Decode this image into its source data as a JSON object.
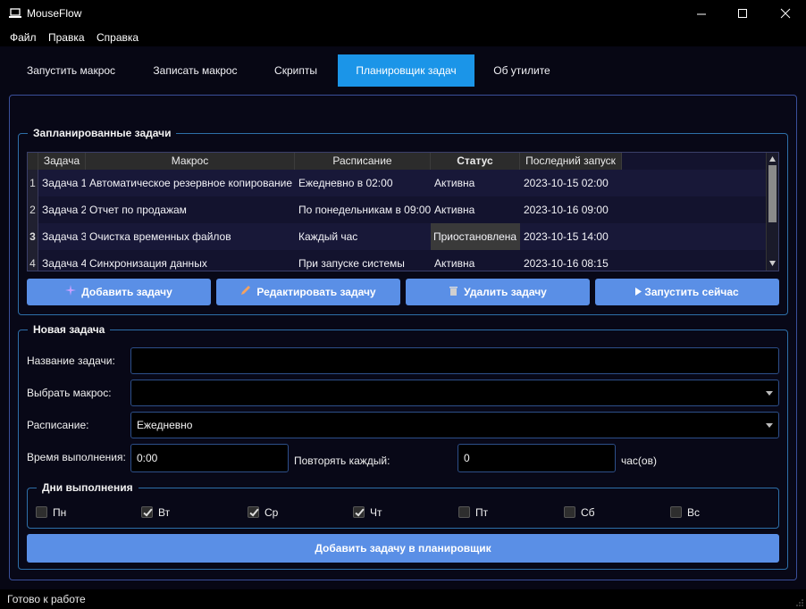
{
  "window": {
    "title": "MouseFlow"
  },
  "menu": [
    "Файл",
    "Правка",
    "Справка"
  ],
  "tabs": [
    "Запустить макрос",
    "Записать макрос",
    "Скрипты",
    "Планировщик задач",
    "Об утилите"
  ],
  "active_tab": "Планировщик задач",
  "scheduled": {
    "title": "Запланированные задачи",
    "columns": [
      "Задача",
      "Макрос",
      "Расписание",
      "Статус",
      "Последний запуск"
    ],
    "rows": [
      {
        "num": "1",
        "task": "Задача 1",
        "macro": "Автоматическое резервное копирование",
        "schedule": "Ежедневно в 02:00",
        "status": "Активна",
        "last_run": "2023-10-15 02:00"
      },
      {
        "num": "2",
        "task": "Задача 2",
        "macro": "Отчет по продажам",
        "schedule": "По понедельникам в 09:00",
        "status": "Активна",
        "last_run": "2023-10-16 09:00"
      },
      {
        "num": "3",
        "task": "Задача 3",
        "macro": "Очистка временных файлов",
        "schedule": "Каждый час",
        "status": "Приостановлена",
        "last_run": "2023-10-15 14:00"
      },
      {
        "num": "4",
        "task": "Задача 4",
        "macro": "Синхронизация данных",
        "schedule": "При запуске системы",
        "status": "Активна",
        "last_run": "2023-10-16 08:15"
      }
    ],
    "buttons": {
      "add": "Добавить задачу",
      "edit": "Редактировать задачу",
      "delete": "Удалить задачу",
      "run": "Запустить сейчас"
    }
  },
  "new_task": {
    "title": "Новая задача",
    "name_label": "Название задачи:",
    "name_value": "",
    "macro_label": "Выбрать макрос:",
    "macro_value": "",
    "schedule_label": "Расписание:",
    "schedule_value": "Ежедневно",
    "time_label": "Время выполнения:",
    "time_value": "0:00",
    "repeat_label": "Повторять каждый:",
    "repeat_value": "0",
    "repeat_unit": "час(ов)",
    "days_title": "Дни выполнения",
    "days": [
      {
        "label": "Пн",
        "checked": false
      },
      {
        "label": "Вт",
        "checked": true
      },
      {
        "label": "Ср",
        "checked": true
      },
      {
        "label": "Чт",
        "checked": true
      },
      {
        "label": "Пт",
        "checked": false
      },
      {
        "label": "Сб",
        "checked": false
      },
      {
        "label": "Вс",
        "checked": false
      }
    ],
    "submit": "Добавить задачу в планировщик"
  },
  "status": "Готово к работе",
  "colors": {
    "accent": "#1b95e8",
    "button": "#5a8fe6",
    "background": "#080817",
    "border": "#2d6fa8"
  }
}
